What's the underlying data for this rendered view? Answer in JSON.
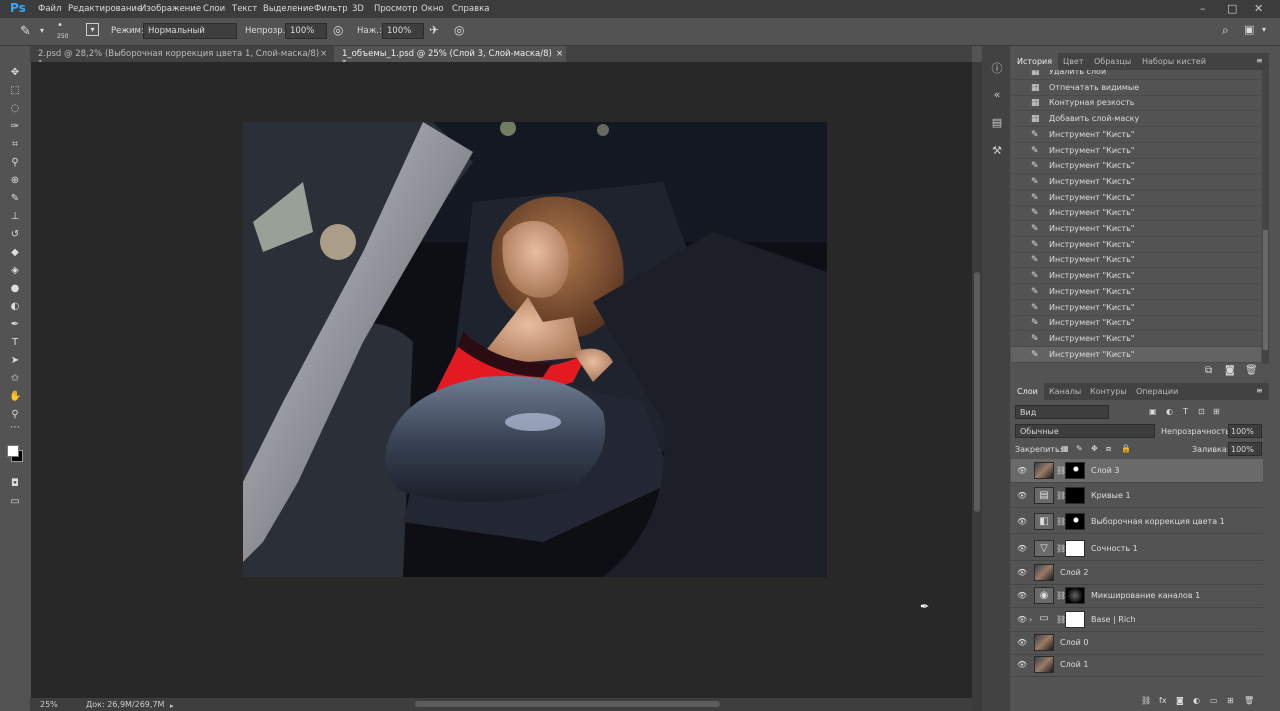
{
  "app": {
    "logo": "Ps"
  },
  "menu": [
    "Файл",
    "Редактирование",
    "Изображение",
    "Слои",
    "Текст",
    "Выделение",
    "Фильтр",
    "3D",
    "Просмотр",
    "Окно",
    "Справка"
  ],
  "options": {
    "brush_size": "250",
    "mode_label": "Режим:",
    "mode_value": "Нормальный",
    "opacity_label": "Непрозр.:",
    "opacity_value": "100%",
    "pressure_label": "Наж.:",
    "pressure_value": "100%"
  },
  "tabs": [
    {
      "label": "2.psd @ 28,2% (Выборочная коррекция цвета 1, Слой-маска/8) *",
      "active": false
    },
    {
      "label": "1_объемы_1.psd @ 25% (Слой 3, Слой-маска/8) *",
      "active": true
    }
  ],
  "status": {
    "zoom": "25%",
    "doc": "Док: 26,9M/269,7M"
  },
  "history": {
    "tabs": [
      "История",
      "Цвет",
      "Образцы",
      "Наборы кистей"
    ],
    "items": [
      {
        "label": "Удалить слой",
        "icon": "action"
      },
      {
        "label": "Отпечатать видимые",
        "icon": "action"
      },
      {
        "label": "Контурная резкость",
        "icon": "action"
      },
      {
        "label": "Добавить слой-маску",
        "icon": "action"
      },
      {
        "label": "Инструмент \"Кисть\"",
        "icon": "brush"
      },
      {
        "label": "Инструмент \"Кисть\"",
        "icon": "brush"
      },
      {
        "label": "Инструмент \"Кисть\"",
        "icon": "brush"
      },
      {
        "label": "Инструмент \"Кисть\"",
        "icon": "brush"
      },
      {
        "label": "Инструмент \"Кисть\"",
        "icon": "brush"
      },
      {
        "label": "Инструмент \"Кисть\"",
        "icon": "brush"
      },
      {
        "label": "Инструмент \"Кисть\"",
        "icon": "brush"
      },
      {
        "label": "Инструмент \"Кисть\"",
        "icon": "brush"
      },
      {
        "label": "Инструмент \"Кисть\"",
        "icon": "brush"
      },
      {
        "label": "Инструмент \"Кисть\"",
        "icon": "brush"
      },
      {
        "label": "Инструмент \"Кисть\"",
        "icon": "brush"
      },
      {
        "label": "Инструмент \"Кисть\"",
        "icon": "brush"
      },
      {
        "label": "Инструмент \"Кисть\"",
        "icon": "brush"
      },
      {
        "label": "Инструмент \"Кисть\"",
        "icon": "brush"
      },
      {
        "label": "Инструмент \"Кисть\"",
        "icon": "brush",
        "selected": true
      }
    ]
  },
  "layers": {
    "tabs": [
      "Слои",
      "Каналы",
      "Контуры",
      "Операции"
    ],
    "filter": "Вид",
    "blend": "Обычные",
    "opacity_label": "Непрозрачность:",
    "opacity": "100%",
    "lock_label": "Закрепить:",
    "fill_label": "Заливка:",
    "fill": "100%",
    "items": [
      {
        "name": "Слой 3",
        "thumb": "photo",
        "mask": "black-spot",
        "selected": true
      },
      {
        "name": "Кривые 1",
        "thumb": "curves",
        "mask": "black"
      },
      {
        "name": "Выборочная коррекция цвета 1",
        "thumb": "selective",
        "mask": "black-spot"
      },
      {
        "name": "Сочность 1",
        "thumb": "vibrance",
        "mask": "white"
      },
      {
        "name": "Слой 2",
        "thumb": "photo",
        "mask": ""
      },
      {
        "name": "Микширование каналов 1",
        "thumb": "mixer",
        "mask": "grad"
      },
      {
        "name": "Base | Rich",
        "thumb": "folder",
        "mask": "white"
      },
      {
        "name": "Слой 0",
        "thumb": "photo",
        "mask": ""
      },
      {
        "name": "Слой 1",
        "thumb": "photo",
        "mask": ""
      }
    ]
  },
  "colors": {
    "accent": "#31a8ff",
    "panel": "#535353",
    "dark": "#282828",
    "selected_row": "#6a6a6a"
  }
}
